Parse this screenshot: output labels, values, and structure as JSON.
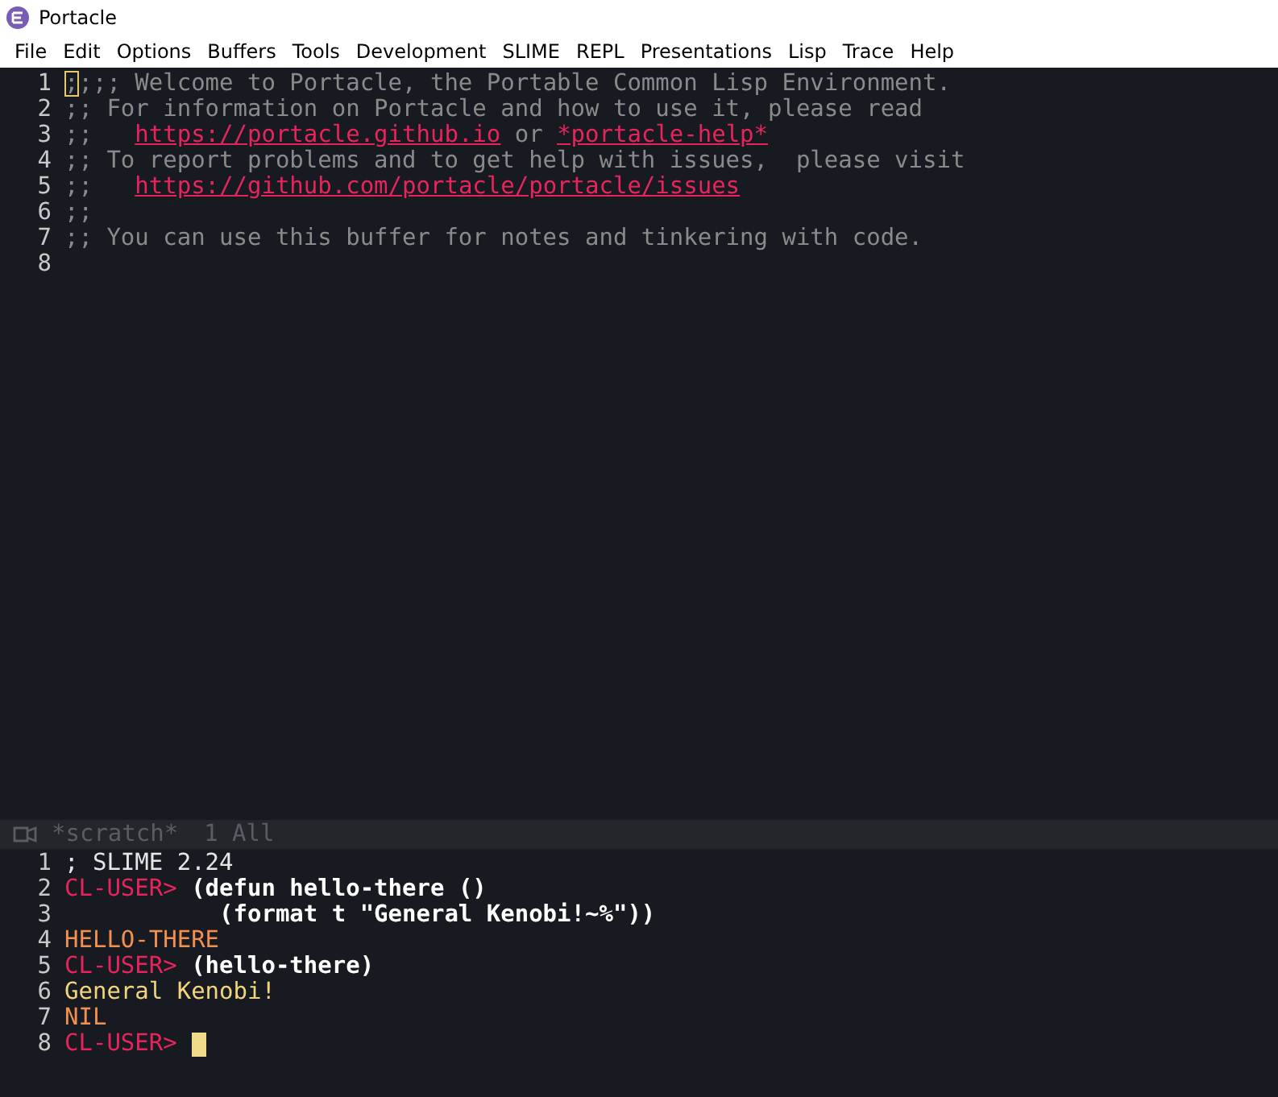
{
  "window": {
    "title": "Portacle"
  },
  "menu": [
    "File",
    "Edit",
    "Options",
    "Buffers",
    "Tools",
    "Development",
    "SLIME",
    "REPL",
    "Presentations",
    "Lisp",
    "Trace",
    "Help"
  ],
  "editor": {
    "lines": [
      {
        "number": "1",
        "segments": [
          {
            "kind": "cursor",
            "text": ";"
          },
          {
            "kind": "comment",
            "text": ";;; Welcome to Portacle, the Portable Common Lisp Environment."
          }
        ]
      },
      {
        "number": "2",
        "segments": [
          {
            "kind": "comment",
            "text": ";; For information on Portacle and how to use it, please read"
          }
        ]
      },
      {
        "number": "3",
        "segments": [
          {
            "kind": "comment",
            "text": ";;   "
          },
          {
            "kind": "link",
            "text": "https://portacle.github.io"
          },
          {
            "kind": "comment",
            "text": " or "
          },
          {
            "kind": "link",
            "text": "*portacle-help*"
          }
        ]
      },
      {
        "number": "4",
        "segments": [
          {
            "kind": "comment",
            "text": ";; To report problems and to get help with issues,  please visit"
          }
        ]
      },
      {
        "number": "5",
        "segments": [
          {
            "kind": "comment",
            "text": ";;   "
          },
          {
            "kind": "link",
            "text": "https://github.com/portacle/portacle/issues"
          }
        ]
      },
      {
        "number": "6",
        "segments": [
          {
            "kind": "comment",
            "text": ";;"
          }
        ]
      },
      {
        "number": "7",
        "segments": [
          {
            "kind": "comment",
            "text": ";; You can use this buffer for notes and tinkering with code."
          }
        ]
      },
      {
        "number": "8"
      }
    ]
  },
  "mode_line": {
    "buffer": "*scratch*",
    "position": "1 All"
  },
  "repl": {
    "lines": [
      {
        "number": "1",
        "segments": [
          {
            "kind": "output",
            "text": "; SLIME 2.24"
          }
        ]
      },
      {
        "number": "2",
        "segments": [
          {
            "kind": "prompt",
            "text": "CL-USER>"
          },
          {
            "kind": "input",
            "text": " (defun hello-there ()"
          }
        ]
      },
      {
        "number": "3",
        "segments": [
          {
            "kind": "input",
            "text": "           (format t \"General Kenobi!~%\"))"
          }
        ]
      },
      {
        "number": "4",
        "segments": [
          {
            "kind": "result",
            "text": "HELLO-THERE"
          }
        ]
      },
      {
        "number": "5",
        "segments": [
          {
            "kind": "prompt",
            "text": "CL-USER>"
          },
          {
            "kind": "input",
            "text": " (hello-there)"
          }
        ]
      },
      {
        "number": "6",
        "segments": [
          {
            "kind": "printed",
            "text": "General Kenobi!"
          }
        ]
      },
      {
        "number": "7",
        "segments": [
          {
            "kind": "result",
            "text": "NIL"
          }
        ]
      },
      {
        "number": "8",
        "segments": [
          {
            "kind": "prompt",
            "text": "CL-USER>"
          }
        ],
        "cursor": true
      }
    ]
  }
}
